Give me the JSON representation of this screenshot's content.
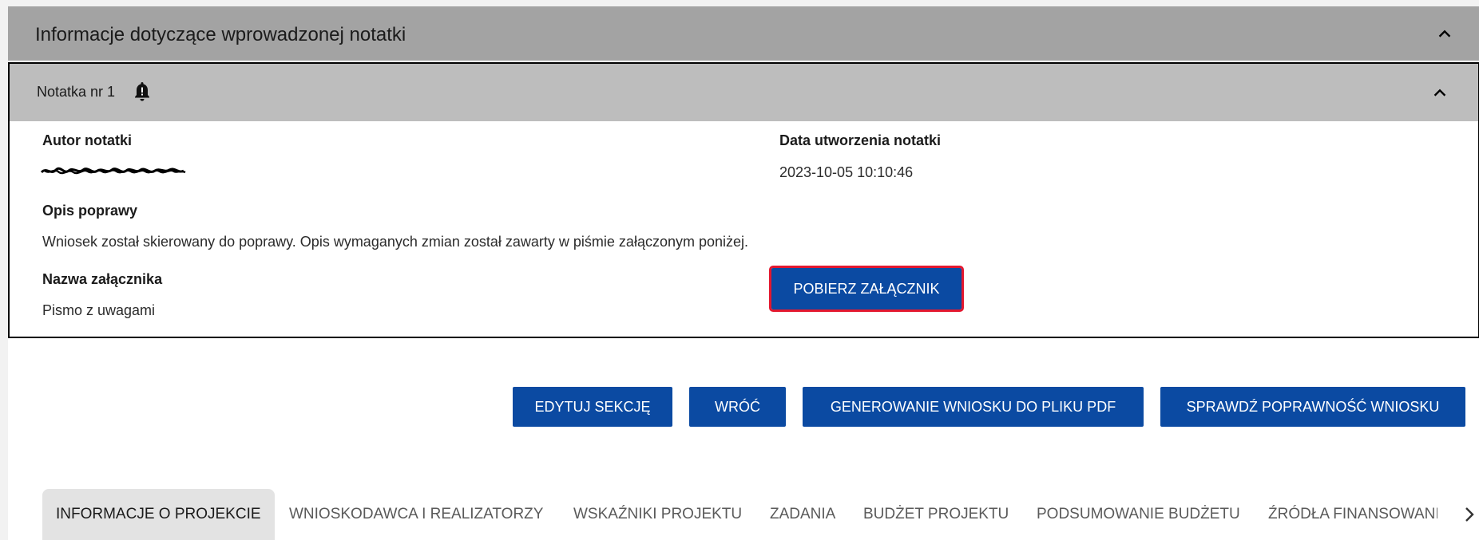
{
  "section": {
    "title": "Informacje dotyczące wprowadzonej notatki"
  },
  "note": {
    "title": "Notatka nr 1",
    "author_label": "Autor notatki",
    "date_label": "Data utworzenia notatki",
    "date_value": "2023-10-05 10:10:46",
    "description_label": "Opis poprawy",
    "description_value": "Wniosek został skierowany do poprawy. Opis wymaganych zmian został zawarty w piśmie załączonym poniżej.",
    "attachment_label": "Nazwa załącznika",
    "attachment_value": "Pismo z uwagami",
    "download_button": "POBIERZ ZAŁĄCZNIK"
  },
  "actions": {
    "edit": "EDYTUJ SEKCJĘ",
    "back": "WRÓĆ",
    "pdf": "GENEROWANIE WNIOSKU DO PLIKU PDF",
    "validate": "SPRAWDŹ POPRAWNOŚĆ WNIOSKU"
  },
  "tabs": [
    {
      "label": "INFORMACJE O PROJEKCIE",
      "active": true
    },
    {
      "label": "WNIOSKODAWCA I REALIZATORZY"
    },
    {
      "label": "WSKAŹNIKI PROJEKTU"
    },
    {
      "label": "ZADANIA"
    },
    {
      "label": "BUDŻET PROJEKTU"
    },
    {
      "label": "PODSUMOWANIE BUDŻETU"
    },
    {
      "label": "ŹRÓDŁA FINANSOWANI"
    }
  ],
  "colors": {
    "primary": "#0b4aa2",
    "highlight": "#e3182f",
    "header": "#a3a3a3",
    "subheader": "#bdbdbd"
  },
  "icons": {
    "collapse": "chevron-up-icon",
    "bell": "bell-alert-icon",
    "next_tab": "chevron-right-icon"
  }
}
